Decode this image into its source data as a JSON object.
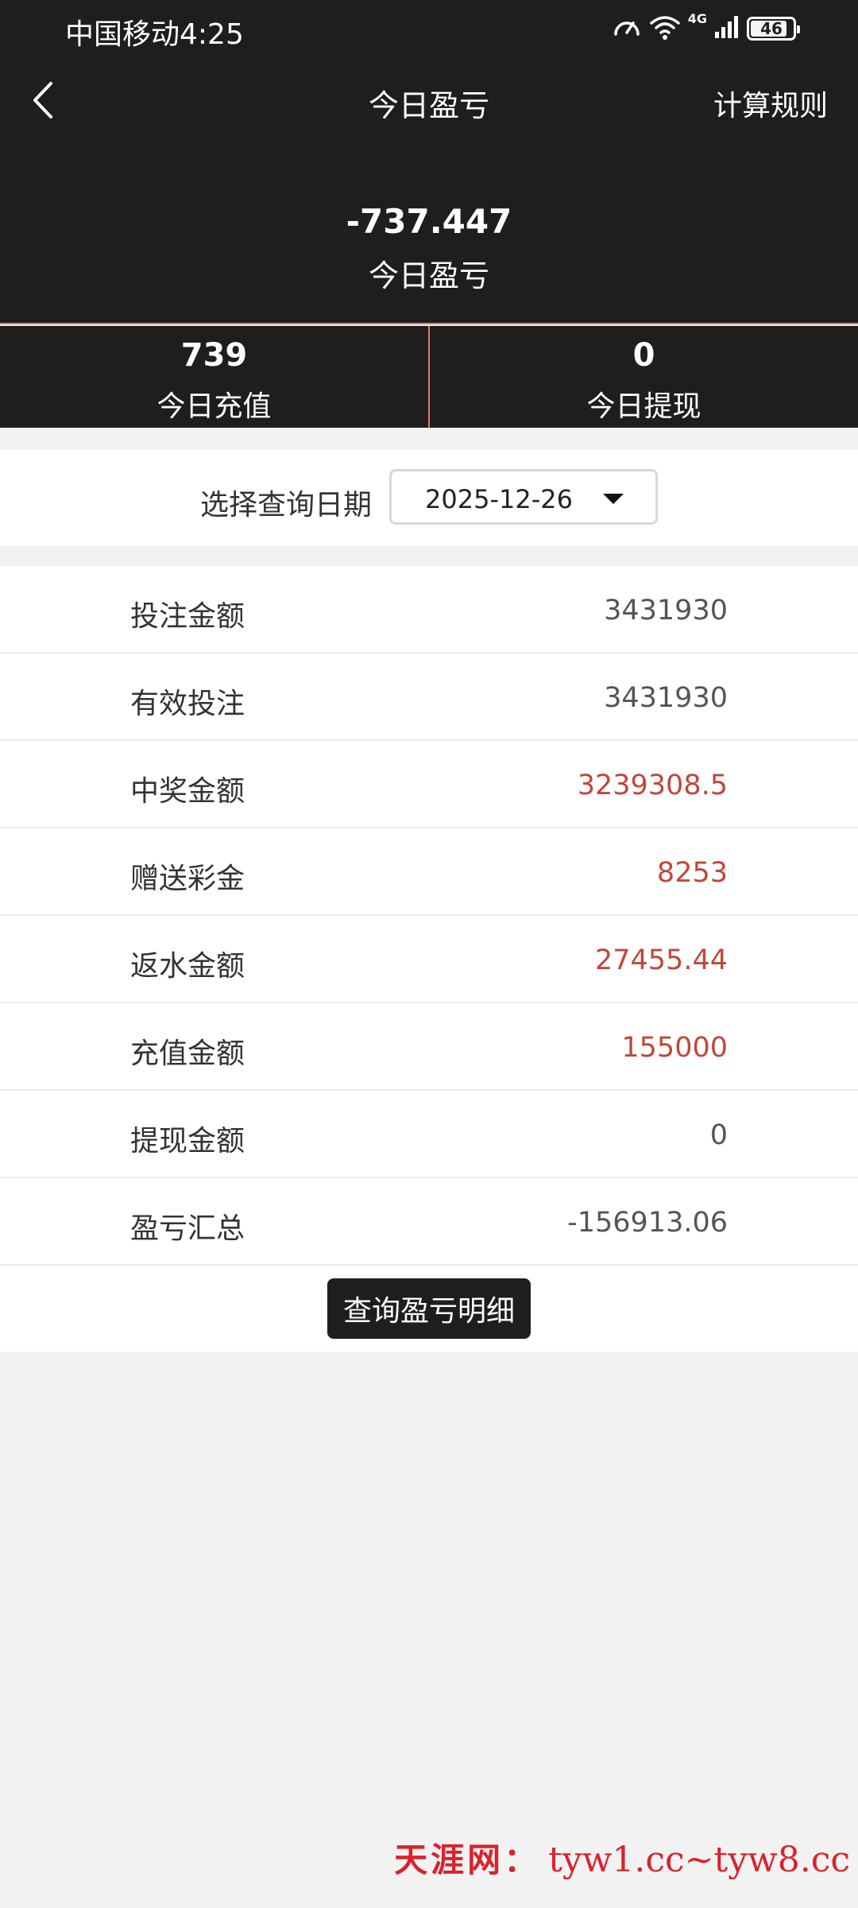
{
  "status_bar": {
    "carrier_time": "中国移动4:25",
    "network_label": "4G",
    "battery_level": "46"
  },
  "nav": {
    "title": "今日盈亏",
    "right_action": "计算规则"
  },
  "hero": {
    "value": "-737.447",
    "label": "今日盈亏"
  },
  "stats": [
    {
      "value": "739",
      "label": "今日充值"
    },
    {
      "value": "0",
      "label": "今日提现"
    }
  ],
  "date_picker": {
    "label": "选择查询日期",
    "value": "2025-12-26"
  },
  "rows": [
    {
      "label": "投注金额",
      "value": "3431930"
    },
    {
      "label": "有效投注",
      "value": "3431930"
    },
    {
      "label": "中奖金额",
      "value": "3239308.5"
    },
    {
      "label": "赠送彩金",
      "value": "8253"
    },
    {
      "label": "返水金额",
      "value": "27455.44"
    },
    {
      "label": "充值金额",
      "value": "155000"
    },
    {
      "label": "提现金额",
      "value": "0"
    },
    {
      "label": "盈亏汇总",
      "value": "-156913.06"
    }
  ],
  "query_button": "查询盈亏明细",
  "watermark": {
    "name": "天涯网：",
    "url": "tyw1.cc~tyw8.cc"
  },
  "colors": {
    "header_bg": "#1e1e1e",
    "accent_red": "#c0473a",
    "divider_accent": "#e07a6a"
  }
}
